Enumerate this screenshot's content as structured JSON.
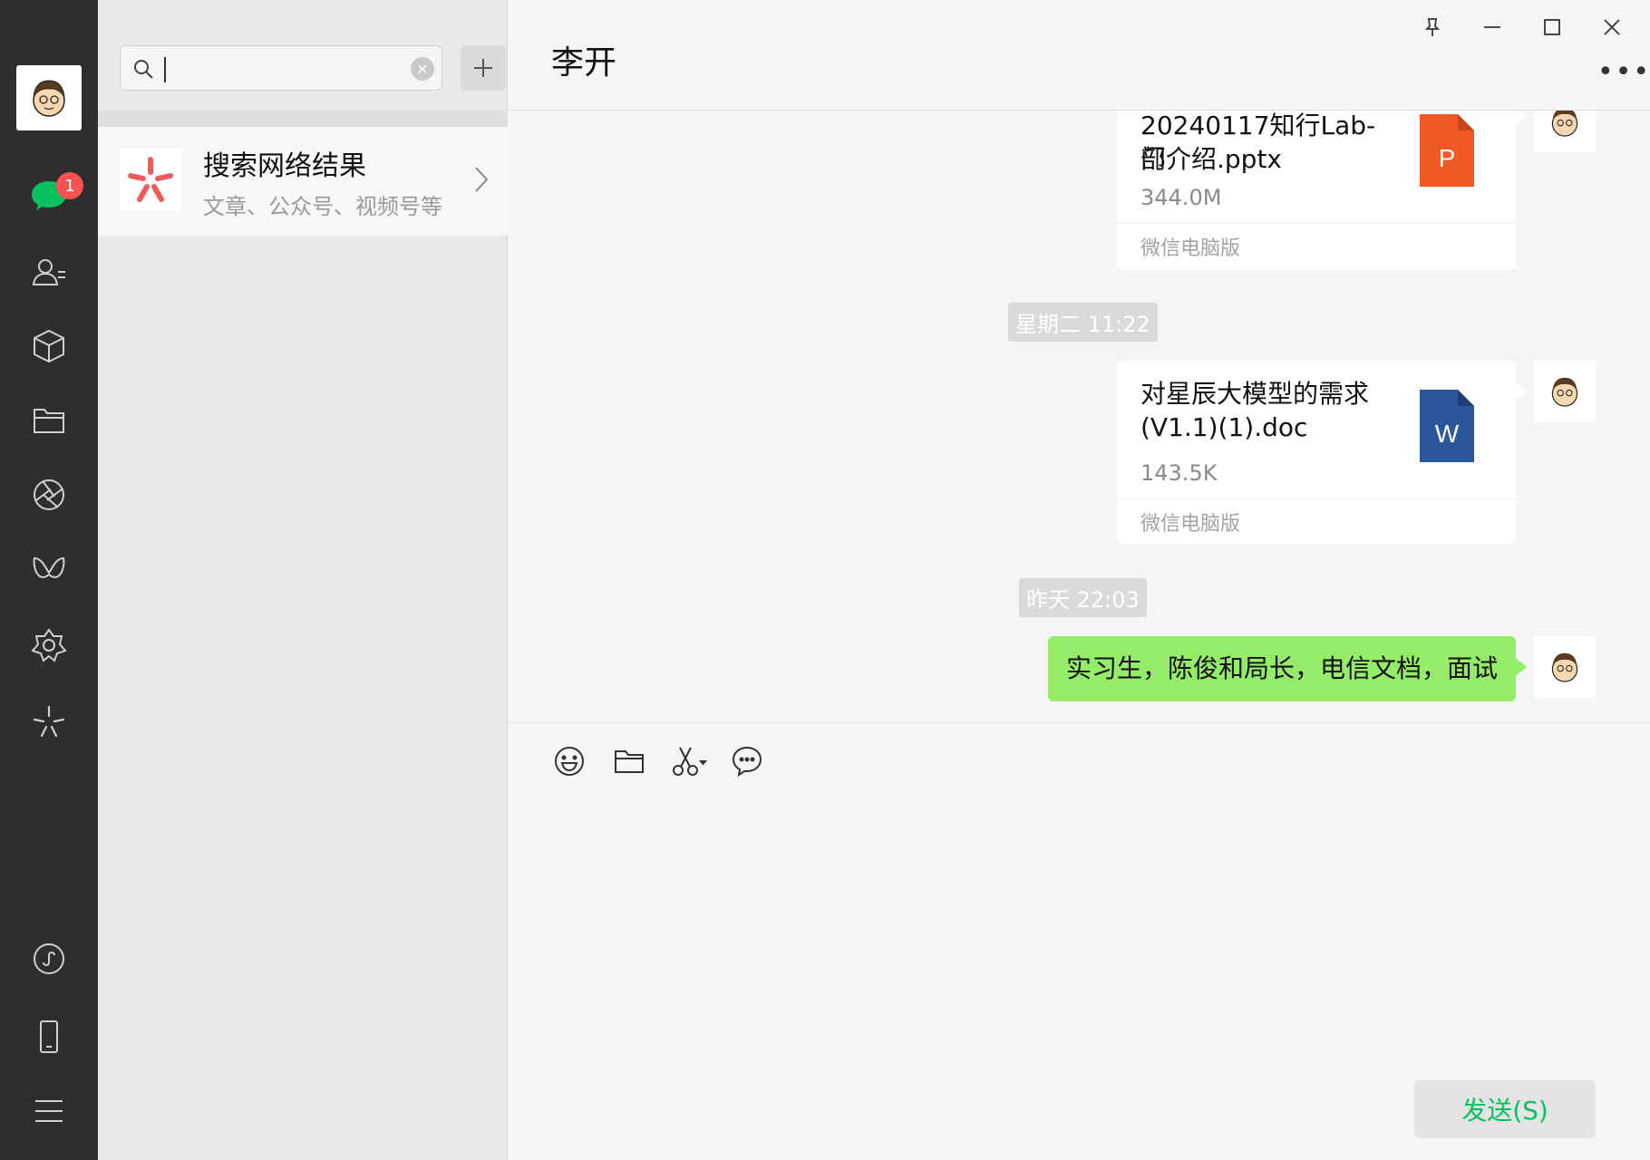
{
  "sidebar": {
    "unread_badge": "1",
    "icons": [
      "chat-icon",
      "contacts-icon",
      "favorites-icon",
      "files-icon",
      "moments-icon",
      "channels-icon",
      "search-feature-icon",
      "mini-programs-icon",
      "phone-icon",
      "menu-icon"
    ]
  },
  "search": {
    "placeholder": "",
    "value": ""
  },
  "search_result": {
    "title": "搜索网络结果",
    "subtitle": "文章、公众号、视频号等"
  },
  "chat": {
    "contact_name": "李开",
    "messages": [
      {
        "type": "file",
        "name": "20240117知行Lab-部门介绍.pptx",
        "name_line1": "20240117知行Lab-部",
        "name_line2": "门介绍.pptx",
        "size": "344.0M",
        "source": "微信电脑版",
        "file_type": "P"
      },
      {
        "type": "time",
        "text": "星期二 11:22"
      },
      {
        "type": "file",
        "name": "对星辰大模型的需求(V1.1)(1).doc",
        "name_line1": "对星辰大模型的需求",
        "name_line2": "(V1.1)(1).doc",
        "size": "143.5K",
        "source": "微信电脑版",
        "file_type": "W"
      },
      {
        "type": "time",
        "text": "昨天 22:03"
      },
      {
        "type": "text",
        "text": "实习生，陈俊和局长，电信文档，面试"
      }
    ]
  },
  "composer": {
    "send_label": "发送(S)"
  },
  "colors": {
    "rail_bg": "#2e2e2e",
    "accent_green": "#07c160",
    "bubble_green": "#95ec69",
    "badge_red": "#fa5151",
    "ppt_orange": "#f15a24",
    "word_blue": "#2b579a"
  }
}
